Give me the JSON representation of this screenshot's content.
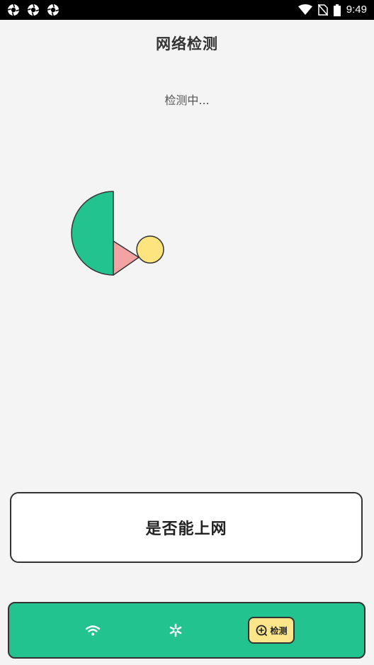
{
  "status_bar": {
    "time": "9:49",
    "left_icons": [
      "aperture-icon",
      "aperture-icon",
      "aperture-icon"
    ],
    "right_icons": [
      "wifi-signal-icon",
      "no-sim-icon",
      "battery-icon"
    ]
  },
  "header": {
    "title": "网络检测"
  },
  "status": {
    "text": "检测中..."
  },
  "pie": {
    "slices": [
      {
        "color": "#22c38f",
        "fraction": 0.5
      },
      {
        "color": "#f4a3a3",
        "fraction": 0.12
      },
      {
        "color": "#fde47f",
        "fraction": 0.08
      }
    ]
  },
  "result_card": {
    "label": "是否能上网"
  },
  "bottom_nav": {
    "items": [
      {
        "icon": "wifi-icon",
        "label": ""
      },
      {
        "icon": "asterisk-icon",
        "label": ""
      },
      {
        "icon": "detect-icon",
        "label": "检测",
        "active": true
      }
    ]
  },
  "colors": {
    "background": "#f4f4f4",
    "accent": "#22c38f",
    "active_tab": "#fde68a",
    "outline": "#333333"
  }
}
